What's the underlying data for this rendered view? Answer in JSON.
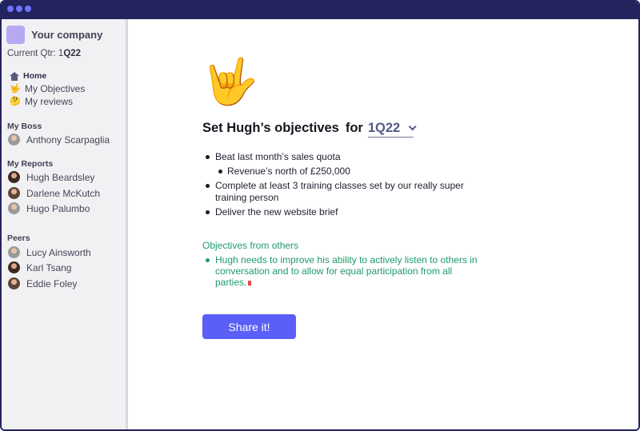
{
  "sidebar": {
    "company_name": "Your company",
    "current_qtr_label": "Current Qtr: 1",
    "current_qtr_value": "Q22",
    "nav": [
      {
        "label": "Home",
        "icon": "home-icon"
      },
      {
        "label": "My Objectives",
        "icon": "rock-hand-icon"
      },
      {
        "label": "My reviews",
        "icon": "thinking-face-icon"
      }
    ],
    "sections": {
      "boss": {
        "title": "My Boss",
        "people": [
          "Anthony Scarpaglia"
        ]
      },
      "reports": {
        "title": "My Reports",
        "people": [
          "Hugh Beardsley",
          "Darlene McKutch",
          "Hugo Palumbo"
        ]
      },
      "peers": {
        "title": "Peers",
        "people": [
          "Lucy Ainsworth",
          "Karl Tsang",
          "Eddie Foley"
        ]
      }
    }
  },
  "main": {
    "hero_icon": "rock-hand-icon",
    "heading": "Set Hugh’s objectives",
    "for_label": "for",
    "quarter": "1Q22",
    "objectives": [
      "Beat last month’s sales quota",
      "Revenue’s north of £250,000",
      "Complete at least 3 training classes set by our really super training person",
      "Deliver the new website brief"
    ],
    "others_title": "Objectives from others",
    "others_items": [
      "Hugh needs to improve his ability to actively listen to others in conversation and to allow for equal participation from all parties."
    ],
    "share_button": "Share it!"
  },
  "colors": {
    "titlebar": "#23245e",
    "accent": "#5b5ff7",
    "green_text": "#1e9b6a",
    "sidebar_bg": "#f1f1f3"
  }
}
